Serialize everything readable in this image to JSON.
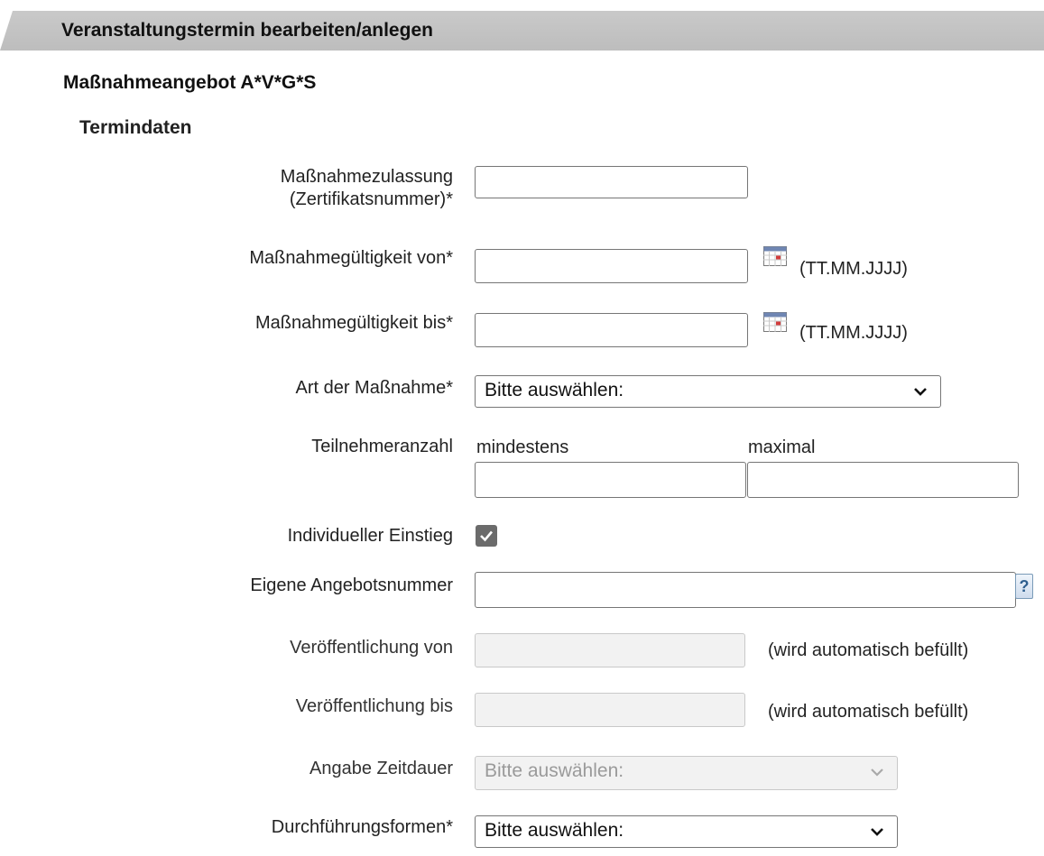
{
  "header": {
    "title": "Veranstaltungstermin bearbeiten/anlegen"
  },
  "offer_title": "Maßnahmeangebot A*V*G*S",
  "section_title": "Termindaten",
  "fields": {
    "zulassung": {
      "label_line1": "Maßnahmezulassung",
      "label_line2": "(Zertifikatsnummer)*",
      "value": ""
    },
    "gueltig_von": {
      "label": "Maßnahmegültigkeit von*",
      "value": "",
      "format_hint": "(TT.MM.JJJJ)",
      "icon": "calendar-icon"
    },
    "gueltig_bis": {
      "label": "Maßnahmegültigkeit bis*",
      "value": "",
      "format_hint": "(TT.MM.JJJJ)",
      "icon": "calendar-icon"
    },
    "art": {
      "label": "Art der Maßnahme*",
      "selected": "Bitte auswählen:"
    },
    "teilnehmer": {
      "label": "Teilnehmeranzahl",
      "min_label": "mindestens",
      "max_label": "maximal",
      "min_value": "",
      "max_value": ""
    },
    "einstieg": {
      "label": "Individueller Einstieg",
      "checked": true
    },
    "angebotsnummer": {
      "label": "Eigene Angebotsnummer",
      "value": "",
      "icon": "help-icon"
    },
    "veroeff_von": {
      "label": "Veröffentlichung von",
      "value": "",
      "hint": "(wird automatisch befüllt)"
    },
    "veroeff_bis": {
      "label": "Veröffentlichung bis",
      "value": "",
      "hint": "(wird automatisch befüllt)"
    },
    "zeitdauer": {
      "label": "Angabe Zeitdauer",
      "selected": "Bitte auswählen:",
      "disabled": true
    },
    "durchfuehrung": {
      "label": "Durchführungsformen*",
      "selected": "Bitte auswählen:"
    }
  },
  "colors": {
    "header_bg": "#c4c4c4",
    "disabled_bg": "#f2f2f2",
    "help_icon": "#2f5f8f"
  }
}
